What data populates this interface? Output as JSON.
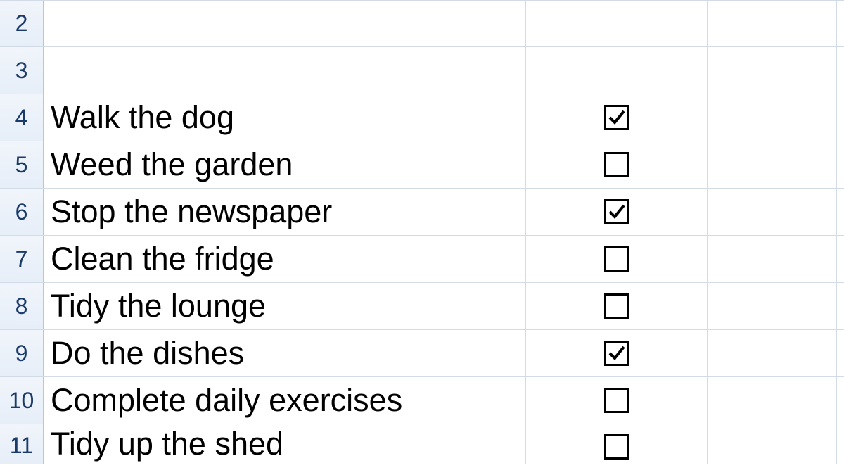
{
  "rows": [
    {
      "num": "2",
      "text": "",
      "checkbox": null
    },
    {
      "num": "3",
      "text": "",
      "checkbox": null
    },
    {
      "num": "4",
      "text": "Walk the dog",
      "checkbox": true
    },
    {
      "num": "5",
      "text": "Weed the garden",
      "checkbox": false
    },
    {
      "num": "6",
      "text": "Stop the newspaper",
      "checkbox": true
    },
    {
      "num": "7",
      "text": "Clean the fridge",
      "checkbox": false
    },
    {
      "num": "8",
      "text": "Tidy the lounge",
      "checkbox": false
    },
    {
      "num": "9",
      "text": "Do the dishes",
      "checkbox": true
    },
    {
      "num": "10",
      "text": "Complete daily exercises",
      "checkbox": false
    },
    {
      "num": "11",
      "text": "Tidy up the shed",
      "checkbox": false
    }
  ]
}
